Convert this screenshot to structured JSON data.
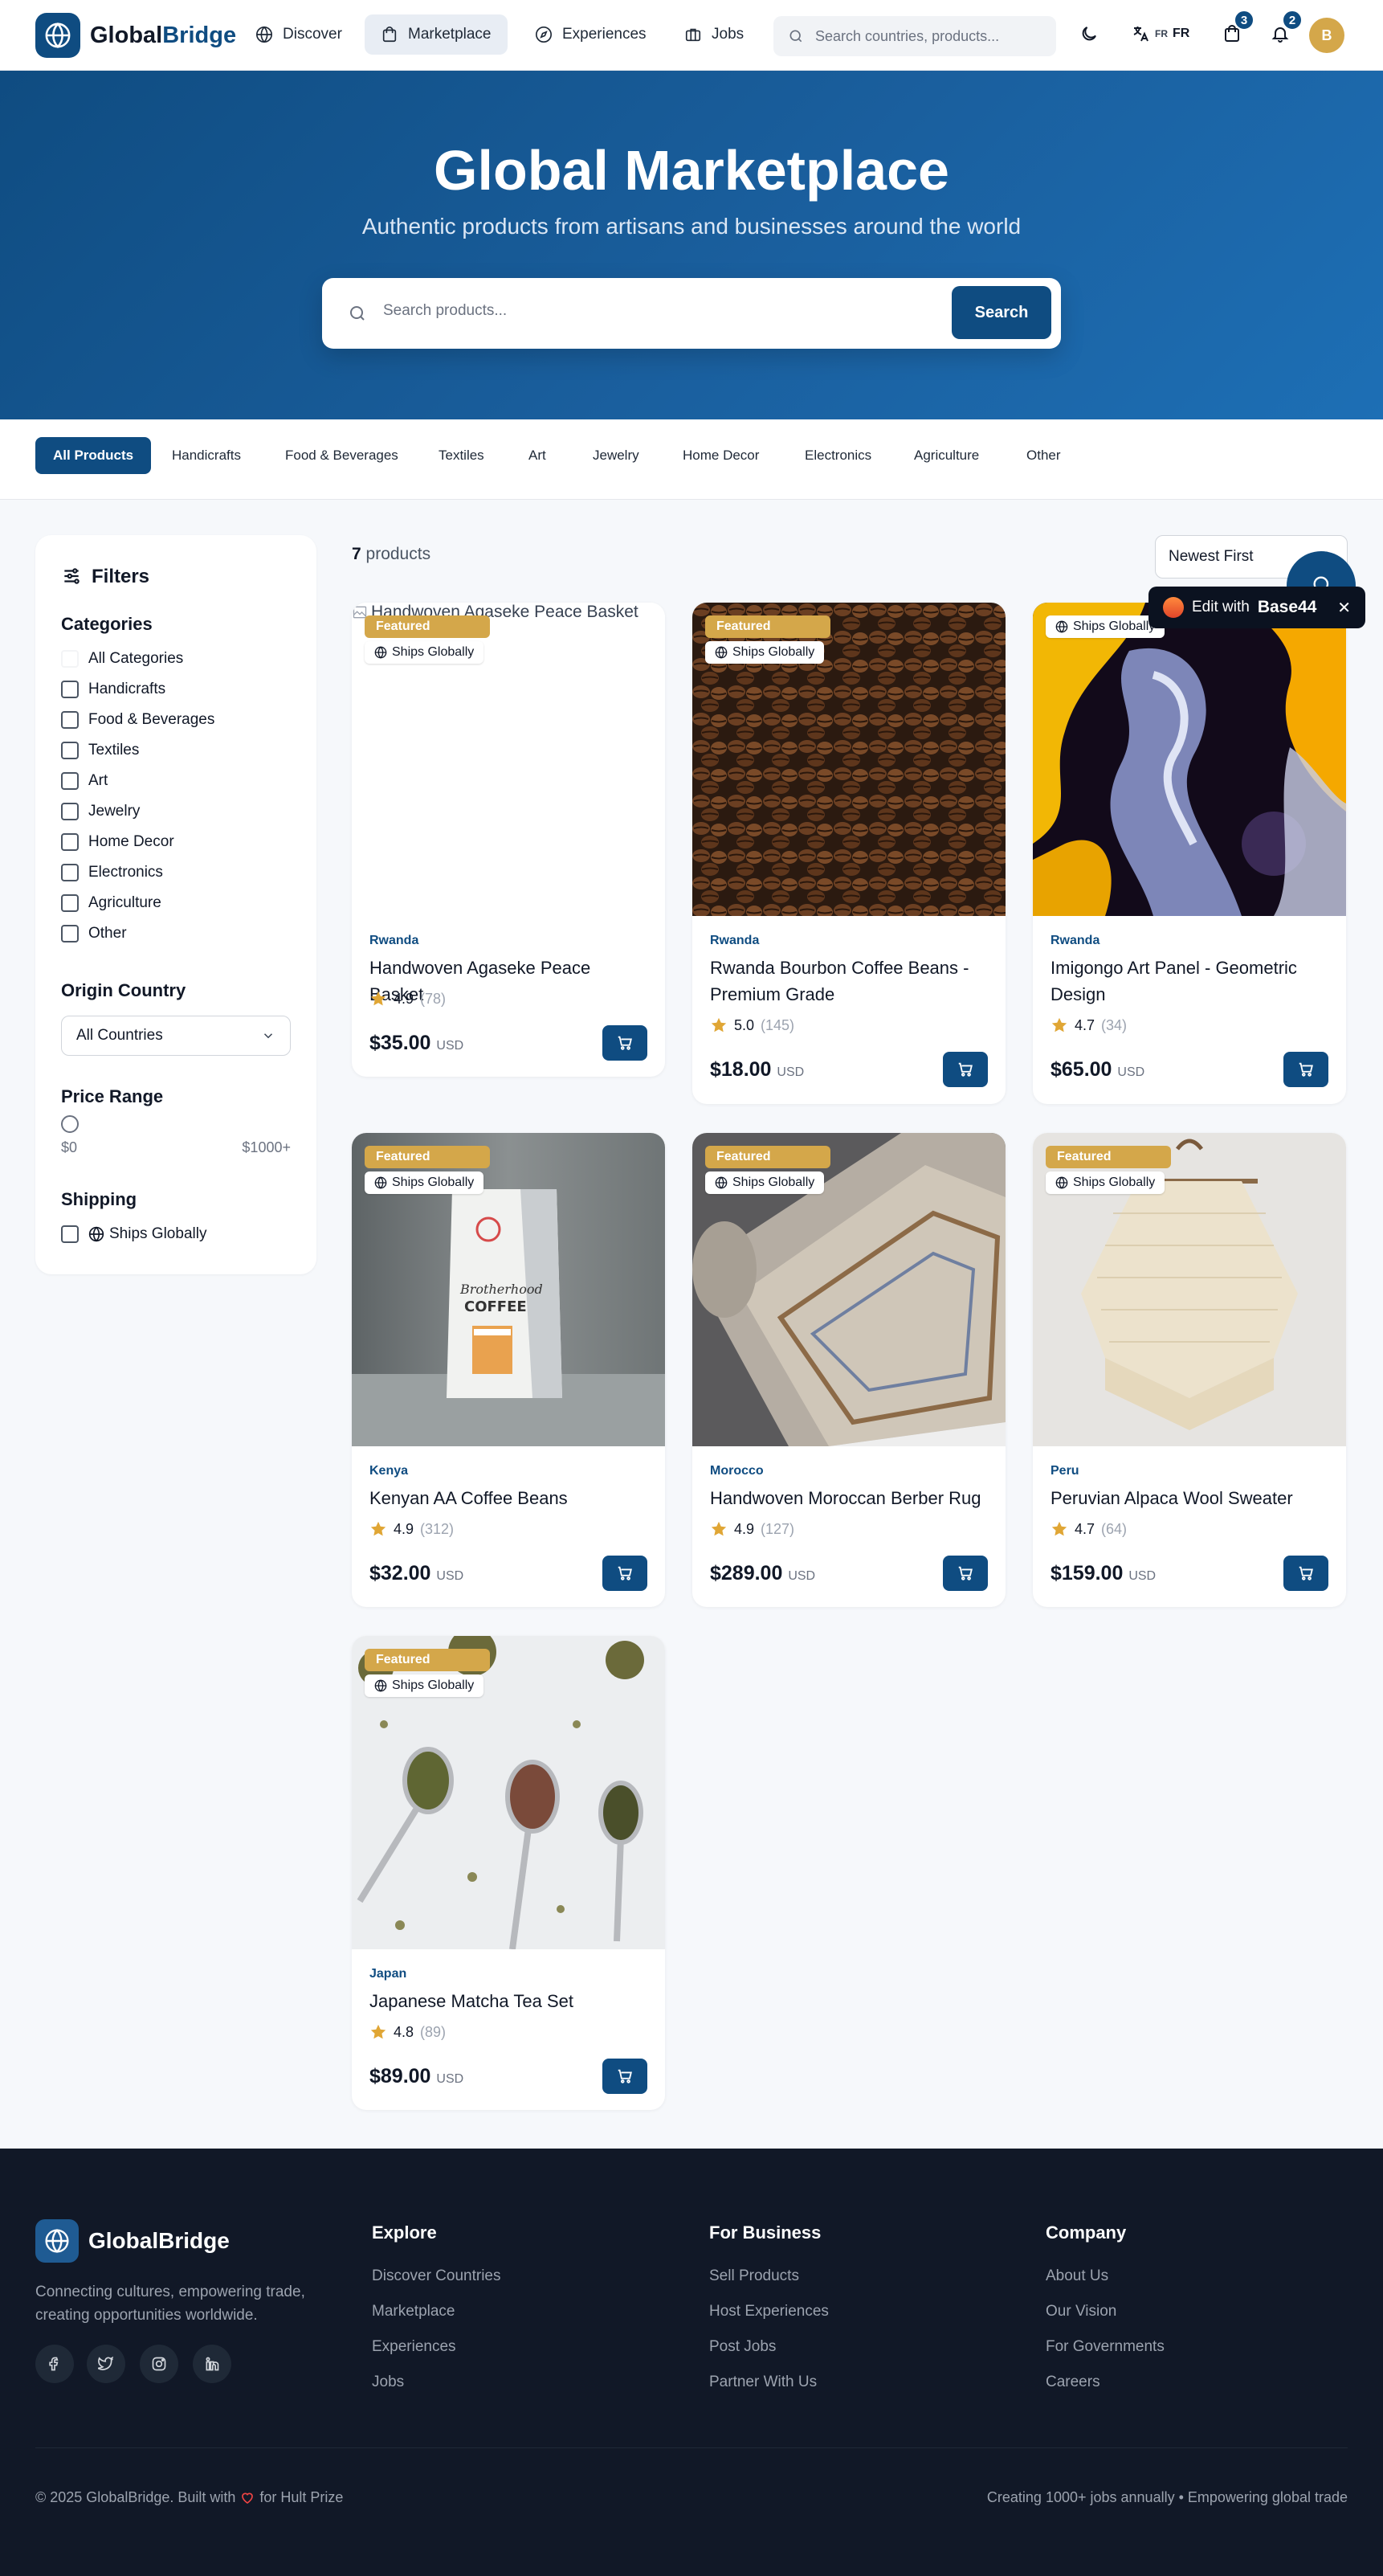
{
  "nav": {
    "brand_prefix": "Global",
    "brand_suffix": "Bridge",
    "links": [
      {
        "label": "Discover",
        "icon": "globe-icon"
      },
      {
        "label": "Marketplace",
        "icon": "shopping-bag-icon"
      },
      {
        "label": "Experiences",
        "icon": "compass-icon"
      },
      {
        "label": "Jobs",
        "icon": "briefcase-icon"
      }
    ],
    "search_placeholder": "Search countries, products...",
    "lang_code": "FR",
    "lang_label": "FR",
    "cart_count": "3",
    "notif_count": "2",
    "avatar_initial": "B"
  },
  "hero": {
    "title": "Global Marketplace",
    "subtitle": "Authentic products from artisans and businesses around the world",
    "search_placeholder": "Search products...",
    "search_button": "Search"
  },
  "categories": [
    "All Products",
    "Handicrafts",
    "Food & Beverages",
    "Textiles",
    "Art",
    "Jewelry",
    "Home Decor",
    "Electronics",
    "Agriculture",
    "Other"
  ],
  "filters": {
    "title": "Filters",
    "categories_heading": "Categories",
    "category_options": [
      "All Categories",
      "Handicrafts",
      "Food & Beverages",
      "Textiles",
      "Art",
      "Jewelry",
      "Home Decor",
      "Electronics",
      "Agriculture",
      "Other"
    ],
    "origin_heading": "Origin Country",
    "origin_value": "All Countries",
    "price_heading": "Price Range",
    "price_min": "$0",
    "price_max": "$1000+",
    "shipping_heading": "Shipping",
    "shipping_option": "Ships Globally"
  },
  "results": {
    "count": "7",
    "count_label": "products",
    "sort_value": "Newest First"
  },
  "badges": {
    "featured": "Featured",
    "ships": "Ships Globally"
  },
  "currency": "USD",
  "products": [
    {
      "country": "Rwanda",
      "name": "Handwoven Agaseke Peace Basket",
      "rating": "4.9",
      "reviews": "(78)",
      "price": "$35.00",
      "featured": true,
      "alt": "Handwoven Agaseke Peace Basket"
    },
    {
      "country": "Rwanda",
      "name": "Rwanda Bourbon Coffee Beans - Premium Grade",
      "rating": "5.0",
      "reviews": "(145)",
      "price": "$18.00",
      "featured": true
    },
    {
      "country": "Rwanda",
      "name": "Imigongo Art Panel - Geometric Design",
      "rating": "4.7",
      "reviews": "(34)",
      "price": "$65.00",
      "featured": false
    },
    {
      "country": "Kenya",
      "name": "Kenyan AA Coffee Beans",
      "rating": "4.9",
      "reviews": "(312)",
      "price": "$32.00",
      "featured": true
    },
    {
      "country": "Morocco",
      "name": "Handwoven Moroccan Berber Rug",
      "rating": "4.9",
      "reviews": "(127)",
      "price": "$289.00",
      "featured": true
    },
    {
      "country": "Peru",
      "name": "Peruvian Alpaca Wool Sweater",
      "rating": "4.7",
      "reviews": "(64)",
      "price": "$159.00",
      "featured": true
    },
    {
      "country": "Japan",
      "name": "Japanese Matcha Tea Set",
      "rating": "4.8",
      "reviews": "(89)",
      "price": "$89.00",
      "featured": true
    }
  ],
  "product_image_text": {
    "coffee_bag_line1": "Brotherhood",
    "coffee_bag_line2": "COFFEE"
  },
  "footer": {
    "brand": "GlobalBridge",
    "tagline": "Connecting cultures, empowering trade, creating opportunities worldwide.",
    "columns": [
      {
        "heading": "Explore",
        "links": [
          "Discover Countries",
          "Marketplace",
          "Experiences",
          "Jobs"
        ]
      },
      {
        "heading": "For Business",
        "links": [
          "Sell Products",
          "Host Experiences",
          "Post Jobs",
          "Partner With Us"
        ]
      },
      {
        "heading": "Company",
        "links": [
          "About Us",
          "Our Vision",
          "For Governments",
          "Careers"
        ]
      }
    ],
    "copyright_prefix": "© 2025 GlobalBridge. Built with",
    "copyright_suffix": "for Hult Prize",
    "right_text": "Creating 1000+ jobs annually • Empowering global trade"
  },
  "edit_widget": {
    "label": "Edit with",
    "brand": "Base44"
  },
  "colors": {
    "primary": "#0f4c81",
    "accent": "#d4a74a",
    "footer_bg": "#111827"
  }
}
